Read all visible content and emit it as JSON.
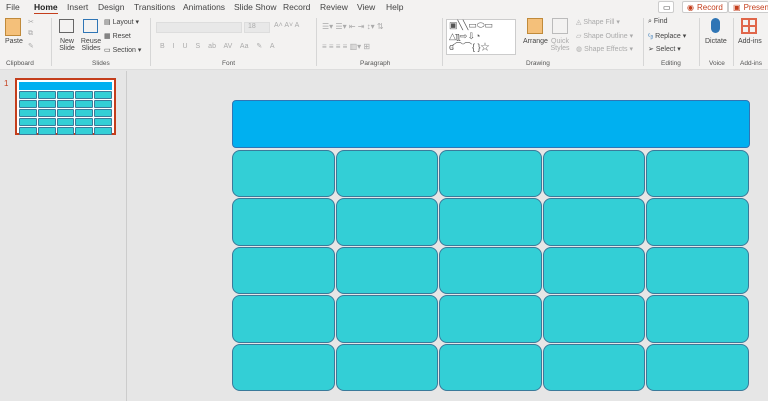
{
  "tabs": [
    "File",
    "Home",
    "Insert",
    "Design",
    "Transitions",
    "Animations",
    "Slide Show",
    "Record",
    "Review",
    "View",
    "Help"
  ],
  "top_buttons": {
    "comment": "",
    "record": "Record",
    "present": "Present"
  },
  "ribbon": {
    "clipboard": {
      "paste": "Paste",
      "group": "Clipboard"
    },
    "slides": {
      "new_slide": "New Slide",
      "reuse": "Reuse Slides",
      "layout": "Layout",
      "reset": "Reset",
      "section": "Section",
      "group": "Slides"
    },
    "font": {
      "size": "18",
      "group": "Font",
      "buttons": [
        "B",
        "I",
        "U",
        "S",
        "ab",
        "AV",
        "Aa",
        "A"
      ]
    },
    "paragraph": {
      "group": "Paragraph"
    },
    "drawing": {
      "arrange": "Arrange",
      "quick_styles": "Quick Styles",
      "shape_fill": "Shape Fill",
      "shape_outline": "Shape Outline",
      "shape_effects": "Shape Effects",
      "group": "Drawing"
    },
    "editing": {
      "find": "Find",
      "replace": "Replace",
      "select": "Select",
      "group": "Editing"
    },
    "voice": {
      "dictate": "Dictate",
      "group": "Voice"
    },
    "addins": {
      "addins": "Add-ins",
      "group": "Add-ins"
    }
  },
  "slide_pane": {
    "number": "1"
  },
  "colors": {
    "header": "#00b0f0",
    "cell": "#33cfd6",
    "accent": "#c43e1c"
  },
  "grid": {
    "rows": 5,
    "cols": 5
  }
}
